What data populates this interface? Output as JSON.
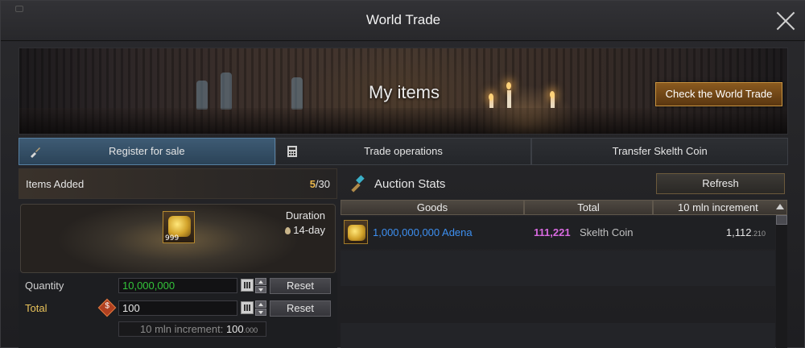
{
  "window": {
    "title": "World Trade"
  },
  "banner": {
    "title": "My items",
    "check_button": "Check the World Trade"
  },
  "tabs": [
    {
      "label": "Register for sale",
      "icon": "broom-icon",
      "active": true
    },
    {
      "label": "Trade operations",
      "icon": "calculator-icon",
      "active": false
    },
    {
      "label": "Transfer Skelth Coin",
      "icon": "",
      "active": false
    }
  ],
  "items": {
    "label": "Items Added",
    "count_current": "5",
    "count_max": "/30",
    "slot_quantity": "999",
    "duration_label": "Duration",
    "duration_value": "14-day"
  },
  "form": {
    "quantity_label": "Quantity",
    "quantity_value": "10,000,000",
    "total_label": "Total",
    "total_value": "100",
    "reset_label": "Reset",
    "increment_label": "10 mln increment:",
    "increment_value": "100",
    "increment_decimal": ".000"
  },
  "auction": {
    "title": "Auction Stats",
    "refresh_label": "Refresh",
    "columns": [
      "Goods",
      "Total",
      "10 mln increment"
    ],
    "rows": [
      {
        "goods": "1,000,000,000 Adena",
        "total": "111,221",
        "unit": "Skelth Coin",
        "increment": "1,112",
        "increment_decimal": ".210"
      }
    ]
  },
  "colors": {
    "accent_gold": "#e8b54a",
    "goods_blue": "#3d8ff0",
    "total_purple": "#d86ae0",
    "quantity_green": "#33c53a"
  }
}
